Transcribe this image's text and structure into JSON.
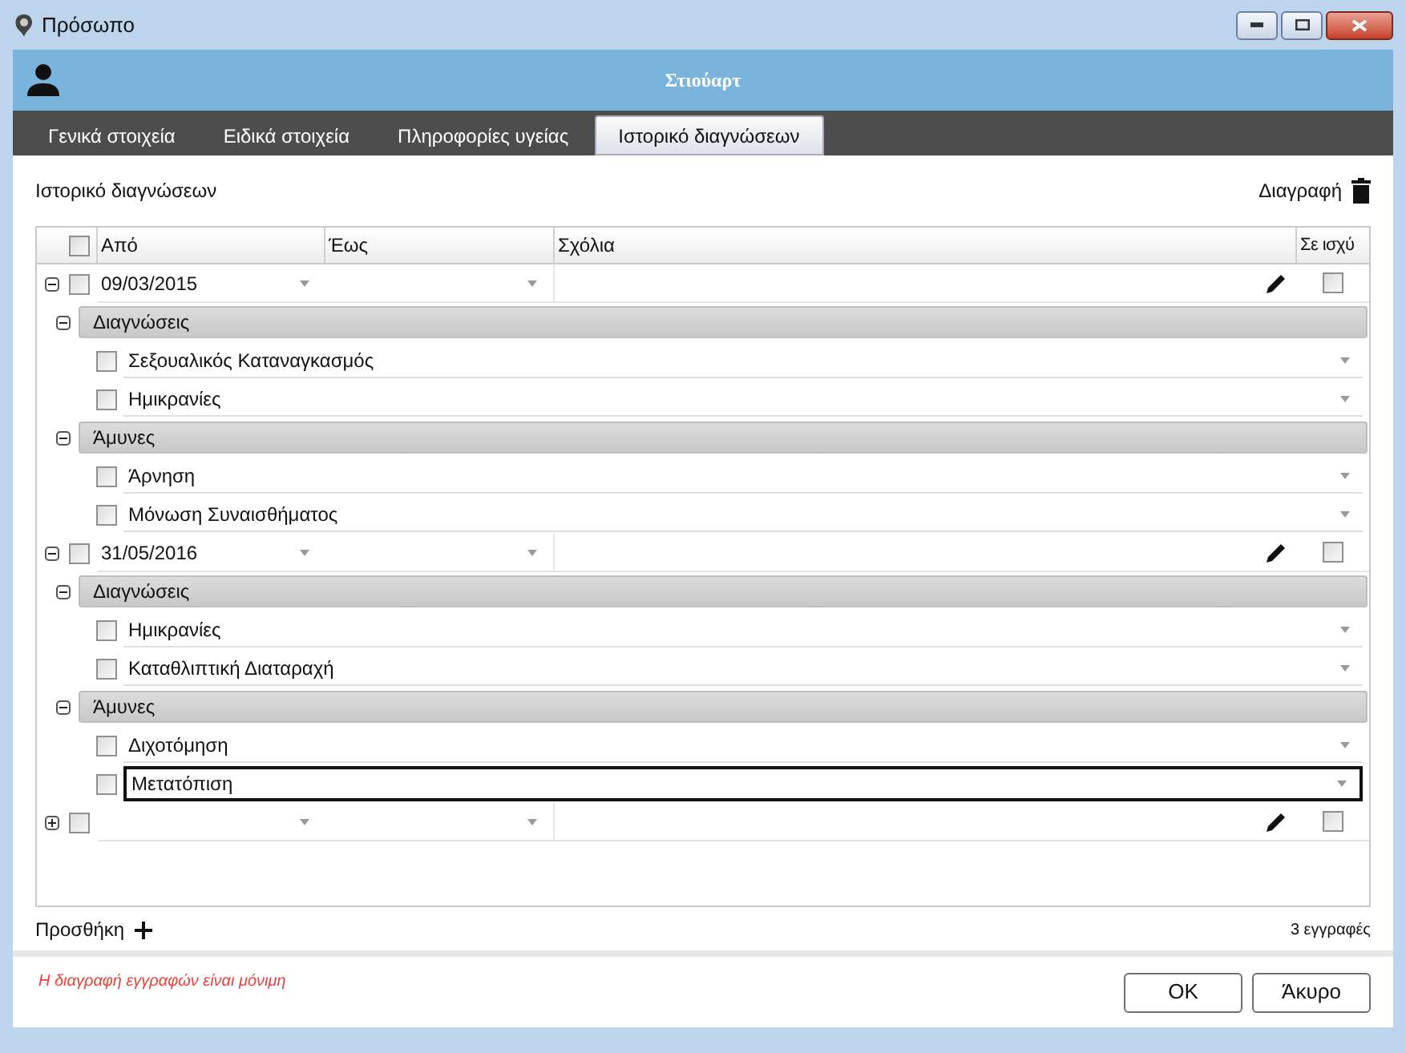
{
  "window": {
    "title": "Πρόσωπο"
  },
  "header": {
    "name": "Στιούαρτ"
  },
  "tabs": [
    {
      "label": "Γενικά στοιχεία",
      "selected": false
    },
    {
      "label": "Ειδικά στοιχεία",
      "selected": false
    },
    {
      "label": "Πληροφορίες υγείας",
      "selected": false
    },
    {
      "label": "Ιστορικό διαγνώσεων",
      "selected": true
    }
  ],
  "section_title": "Ιστορικό διαγνώσεων",
  "delete_label": "Διαγραφή",
  "table": {
    "columns": [
      "Από",
      "Έως",
      "Σχόλια",
      "Σε ισχύ"
    ],
    "all_checked": false,
    "records": [
      {
        "from": "09/03/2015",
        "expanded": true,
        "checked": false,
        "active": false,
        "groups": [
          {
            "label": "Διαγνώσεις",
            "expanded": true,
            "items": [
              {
                "label": "Σεξουαλικός Καταναγκασμός",
                "checked": false,
                "focused": false
              },
              {
                "label": "Ημικρανίες",
                "checked": false,
                "focused": false
              }
            ]
          },
          {
            "label": "Άμυνες",
            "expanded": true,
            "items": [
              {
                "label": "Άρνηση",
                "checked": false,
                "focused": false
              },
              {
                "label": "Μόνωση Συναισθήματος",
                "checked": false,
                "focused": false
              }
            ]
          }
        ]
      },
      {
        "from": "31/05/2016",
        "expanded": true,
        "checked": false,
        "active": false,
        "groups": [
          {
            "label": "Διαγνώσεις",
            "expanded": true,
            "items": [
              {
                "label": "Ημικρανίες",
                "checked": false,
                "focused": false
              },
              {
                "label": "Καταθλιπτική Διαταραχή",
                "checked": false,
                "focused": false
              }
            ]
          },
          {
            "label": "Άμυνες",
            "expanded": true,
            "items": [
              {
                "label": "Διχοτόμηση",
                "checked": false,
                "focused": false
              },
              {
                "label": "Μετατόπιση",
                "checked": false,
                "focused": true
              }
            ]
          }
        ]
      },
      {
        "expanded": false,
        "checked": false,
        "active": false
      }
    ]
  },
  "add_label": "Προσθήκη",
  "record_count": "3 εγγραφές",
  "warning": "Η διαγραφή εγγραφών είναι μόνιμη",
  "buttons": [
    "OK",
    "Άκυρο"
  ]
}
